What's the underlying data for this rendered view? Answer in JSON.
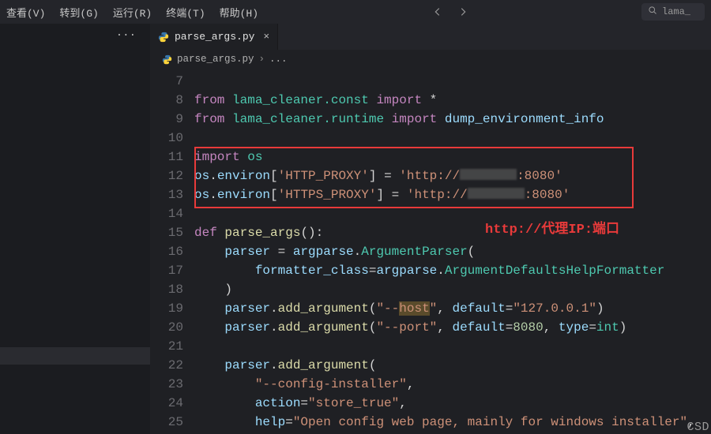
{
  "menu": {
    "items": [
      "查看(V)",
      "转到(G)",
      "运行(R)",
      "终端(T)",
      "帮助(H)"
    ]
  },
  "search": {
    "placeholder": "lama_"
  },
  "tab": {
    "filename": "parse_args.py"
  },
  "breadcrumb": {
    "filename": "parse_args.py",
    "sep": "›",
    "more": "..."
  },
  "annotation": "http://代理IP:端口",
  "watermark": "CSD",
  "code": {
    "lines": [
      {
        "n": 7,
        "segs": []
      },
      {
        "n": 8,
        "segs": [
          [
            "kw",
            "from"
          ],
          [
            "pl",
            " "
          ],
          [
            "mod",
            "lama_cleaner.const"
          ],
          [
            "pl",
            " "
          ],
          [
            "kw",
            "import"
          ],
          [
            "pl",
            " *"
          ]
        ]
      },
      {
        "n": 9,
        "segs": [
          [
            "kw",
            "from"
          ],
          [
            "pl",
            " "
          ],
          [
            "mod",
            "lama_cleaner.runtime"
          ],
          [
            "pl",
            " "
          ],
          [
            "kw",
            "import"
          ],
          [
            "pl",
            " "
          ],
          [
            "var",
            "dump_environment_info"
          ]
        ]
      },
      {
        "n": 10,
        "segs": []
      },
      {
        "n": 11,
        "segs": [
          [
            "kw",
            "import"
          ],
          [
            "pl",
            " "
          ],
          [
            "mod",
            "os"
          ]
        ]
      },
      {
        "n": 12,
        "segs": [
          [
            "var",
            "os"
          ],
          [
            "pl",
            "."
          ],
          [
            "var",
            "environ"
          ],
          [
            "pl",
            "["
          ],
          [
            "str",
            "'HTTP_PROXY'"
          ],
          [
            "pl",
            "] = "
          ],
          [
            "str",
            "'http://"
          ],
          [
            "redact",
            ""
          ],
          [
            "str",
            ":8080'"
          ]
        ]
      },
      {
        "n": 13,
        "segs": [
          [
            "var",
            "os"
          ],
          [
            "pl",
            "."
          ],
          [
            "var",
            "environ"
          ],
          [
            "pl",
            "["
          ],
          [
            "str",
            "'HTTPS_PROXY'"
          ],
          [
            "pl",
            "] = "
          ],
          [
            "str",
            "'http://"
          ],
          [
            "redact",
            ""
          ],
          [
            "str",
            ":8080'"
          ]
        ]
      },
      {
        "n": 14,
        "segs": []
      },
      {
        "n": 15,
        "segs": [
          [
            "kw",
            "def"
          ],
          [
            "pl",
            " "
          ],
          [
            "fn",
            "parse_args"
          ],
          [
            "pl",
            "():"
          ]
        ]
      },
      {
        "n": 16,
        "segs": [
          [
            "pl",
            "    "
          ],
          [
            "var",
            "parser"
          ],
          [
            "pl",
            " = "
          ],
          [
            "var",
            "argparse"
          ],
          [
            "pl",
            "."
          ],
          [
            "type",
            "ArgumentParser"
          ],
          [
            "pl",
            "("
          ]
        ]
      },
      {
        "n": 17,
        "segs": [
          [
            "pl",
            "        "
          ],
          [
            "var",
            "formatter_class"
          ],
          [
            "pl",
            "="
          ],
          [
            "var",
            "argparse"
          ],
          [
            "pl",
            "."
          ],
          [
            "type",
            "ArgumentDefaultsHelpFormatter"
          ]
        ]
      },
      {
        "n": 18,
        "segs": [
          [
            "pl",
            "    )"
          ]
        ]
      },
      {
        "n": 19,
        "segs": [
          [
            "pl",
            "    "
          ],
          [
            "var",
            "parser"
          ],
          [
            "pl",
            "."
          ],
          [
            "fn",
            "add_argument"
          ],
          [
            "pl",
            "("
          ],
          [
            "str",
            "\"--"
          ],
          [
            "hl",
            "host"
          ],
          [
            "str",
            "\""
          ],
          [
            "pl",
            ", "
          ],
          [
            "var",
            "default"
          ],
          [
            "pl",
            "="
          ],
          [
            "str",
            "\"127.0.0.1\""
          ],
          [
            "pl",
            ")"
          ]
        ]
      },
      {
        "n": 20,
        "segs": [
          [
            "pl",
            "    "
          ],
          [
            "var",
            "parser"
          ],
          [
            "pl",
            "."
          ],
          [
            "fn",
            "add_argument"
          ],
          [
            "pl",
            "("
          ],
          [
            "str",
            "\"--port\""
          ],
          [
            "pl",
            ", "
          ],
          [
            "var",
            "default"
          ],
          [
            "pl",
            "="
          ],
          [
            "num",
            "8080"
          ],
          [
            "pl",
            ", "
          ],
          [
            "var",
            "type"
          ],
          [
            "pl",
            "="
          ],
          [
            "type",
            "int"
          ],
          [
            "pl",
            ")"
          ]
        ]
      },
      {
        "n": 21,
        "segs": []
      },
      {
        "n": 22,
        "segs": [
          [
            "pl",
            "    "
          ],
          [
            "var",
            "parser"
          ],
          [
            "pl",
            "."
          ],
          [
            "fn",
            "add_argument"
          ],
          [
            "pl",
            "("
          ]
        ]
      },
      {
        "n": 23,
        "segs": [
          [
            "pl",
            "        "
          ],
          [
            "str",
            "\"--config-installer\""
          ],
          [
            "pl",
            ","
          ]
        ]
      },
      {
        "n": 24,
        "segs": [
          [
            "pl",
            "        "
          ],
          [
            "var",
            "action"
          ],
          [
            "pl",
            "="
          ],
          [
            "str",
            "\"store_true\""
          ],
          [
            "pl",
            ","
          ]
        ]
      },
      {
        "n": 25,
        "segs": [
          [
            "pl",
            "        "
          ],
          [
            "var",
            "help"
          ],
          [
            "pl",
            "="
          ],
          [
            "str",
            "\"Open config web page, mainly for windows installer\""
          ],
          [
            "pl",
            ","
          ]
        ]
      }
    ]
  }
}
